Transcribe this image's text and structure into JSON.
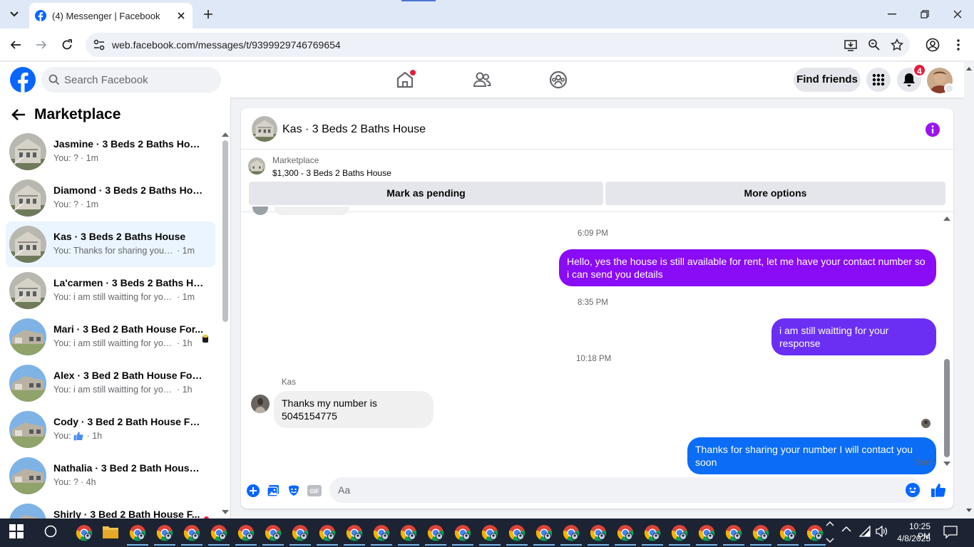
{
  "browser": {
    "tab_title": "(4) Messenger | Facebook",
    "url": "web.facebook.com/messages/t/9399929746769654"
  },
  "fb": {
    "search_placeholder": "Search Facebook",
    "find_friends": "Find friends",
    "notifications_count": "4",
    "accent": "#0866ff"
  },
  "sidebar": {
    "title": "Marketplace",
    "conversations": [
      {
        "name": "Jasmine · 3 Beds 2 Baths House",
        "preview": "You: ?",
        "time": "· 1m",
        "active": false,
        "thumb": "house-gray"
      },
      {
        "name": "Diamond · 3 Beds 2 Baths House",
        "preview": "You: ?",
        "time": "· 1m",
        "active": false,
        "thumb": "house-gray"
      },
      {
        "name": "Kas · 3 Beds 2 Baths House",
        "preview": "You: Thanks for sharing your num...",
        "time": "· 1m",
        "active": true,
        "thumb": "house-gray"
      },
      {
        "name": "La'carmen · 3 Beds 2 Baths House",
        "preview": "You: i am still waitting for your res...",
        "time": "· 1m",
        "active": false,
        "thumb": "house-gray"
      },
      {
        "name": "Mari · 3 Bed 2 Bath House For...",
        "preview": "You: i am still waitting for your r...",
        "time": "· 1h",
        "active": false,
        "thumb": "house-sky"
      },
      {
        "name": "Alex · 3 Bed 2 Bath House For R...",
        "preview": "You: i am still waitting for your res...",
        "time": "· 1h",
        "active": false,
        "thumb": "house-sky"
      },
      {
        "name": "Cody · 3 Bed 2 Bath House For ...",
        "preview": "You:",
        "time": "· 1h",
        "active": false,
        "thumb": "house-sky",
        "like": true
      },
      {
        "name": "Nathalia · 3 Bed 2 Bath House F...",
        "preview": "You: ?",
        "time": "· 4h",
        "active": false,
        "thumb": "house-sky"
      },
      {
        "name": "Shirly · 3 Bed 2 Bath House F...",
        "preview": "",
        "time": "",
        "active": false,
        "thumb": "house-sky"
      }
    ]
  },
  "chat": {
    "title": "Kas · 3 Beds 2 Baths House",
    "marketplace_label": "Marketplace",
    "listing": "$1,300 - 3 Beds 2 Baths House",
    "mark_pending": "Mark as pending",
    "more_options": "More options",
    "timestamps": [
      "6:09 PM",
      "8:35 PM",
      "10:18 PM"
    ],
    "messages": [
      {
        "from": "me",
        "text": "Hello, yes the house is still available for rent, let me have your contact number so i can send you  details"
      },
      {
        "from": "me",
        "text": "i am still waitting for your response"
      },
      {
        "from": "Kas",
        "sender_label": "Kas",
        "text": "Thanks my number is 5045154775"
      },
      {
        "from": "me",
        "text": "Thanks for sharing your number I will contact you soon"
      }
    ],
    "status": "Sent",
    "composer_placeholder": "Aa"
  },
  "taskbar": {
    "time": "10:25 PM",
    "date": "4/8/2025"
  }
}
